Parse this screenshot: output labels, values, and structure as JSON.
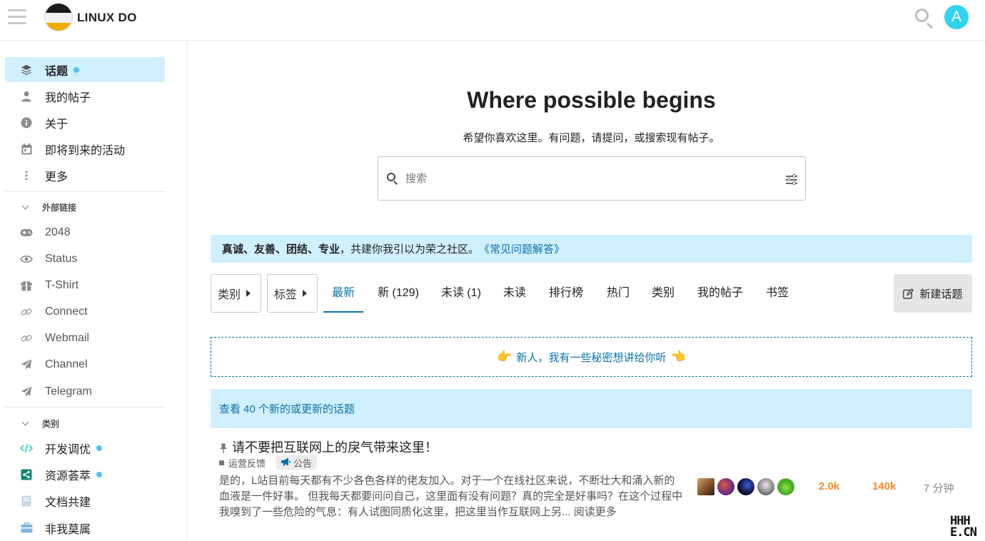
{
  "header": {
    "site_title": "LINUX DO",
    "avatar_letter": "A",
    "colors": {
      "avatar": "#31d3ee",
      "accent": "#0b72a8"
    }
  },
  "sidebar": {
    "main_items": [
      {
        "label": "话题",
        "icon": "layers-icon",
        "active": true,
        "unread": true
      },
      {
        "label": "我的帖子",
        "icon": "user-icon"
      },
      {
        "label": "关于",
        "icon": "info-icon"
      },
      {
        "label": "即将到来的活动",
        "icon": "calendar-icon"
      },
      {
        "label": "更多",
        "icon": "ellipsis-vertical-icon"
      }
    ],
    "external_section": {
      "title": "外部链接",
      "items": [
        {
          "label": "2048",
          "icon": "gamepad-icon"
        },
        {
          "label": "Status",
          "icon": "eye-icon"
        },
        {
          "label": "T-Shirt",
          "icon": "gift-icon"
        },
        {
          "label": "Connect",
          "icon": "link-icon"
        },
        {
          "label": "Webmail",
          "icon": "link-icon"
        },
        {
          "label": "Channel",
          "icon": "paper-plane-icon"
        },
        {
          "label": "Telegram",
          "icon": "paper-plane-icon"
        }
      ]
    },
    "category_section": {
      "title": "类别",
      "items": [
        {
          "label": "开发调优",
          "icon": "code-icon",
          "unread": true
        },
        {
          "label": "资源荟萃",
          "icon": "share-icon",
          "unread": true
        },
        {
          "label": "文档共建",
          "icon": "book-icon"
        },
        {
          "label": "非我莫属",
          "icon": "briefcase-icon"
        }
      ]
    }
  },
  "hero": {
    "title": "Where possible begins",
    "subtitle": "希望你喜欢这里。有问题，请提问，或搜索现有帖子。"
  },
  "search": {
    "placeholder": "搜索"
  },
  "banner": {
    "bold": "真诚、友善、团结、专业",
    "text": "，共建你我引以为荣之社区。",
    "link": "《常见问题解答》"
  },
  "nav": {
    "category_dropdown": "类别",
    "tag_dropdown": "标签",
    "tabs": [
      "最新",
      "新 (129)",
      "未读 (1)",
      "未读",
      "排行榜",
      "热门",
      "类别",
      "我的帖子",
      "书签"
    ],
    "active_tab": 0,
    "new_topic_label": "新建话题"
  },
  "secret_banner": {
    "text": "新人，我有一些秘密想讲给你听"
  },
  "new_topics_bar": {
    "text": "查看 40 个新的或更新的话题"
  },
  "topic": {
    "title": "请不要把互联网上的戾气带来这里！",
    "category": "运营反馈",
    "tag": "公告",
    "excerpt": "是的，L站目前每天都有不少各色各样的佬友加入。对于一个在线社区来说，不断壮大和涌入新的血液是一件好事。 但我每天都要问问自己，这里面有没有问题？真的完全是好事吗？在这个过程中我嗅到了一些危险的气息：有人试图同质化这里，把这里当作互联网上另...",
    "read_more": "阅读更多",
    "replies": "2.0k",
    "views": "140k",
    "activity": "7 分钟"
  },
  "watermark": {
    "line1": "HHH",
    "line2": "E.CN"
  }
}
